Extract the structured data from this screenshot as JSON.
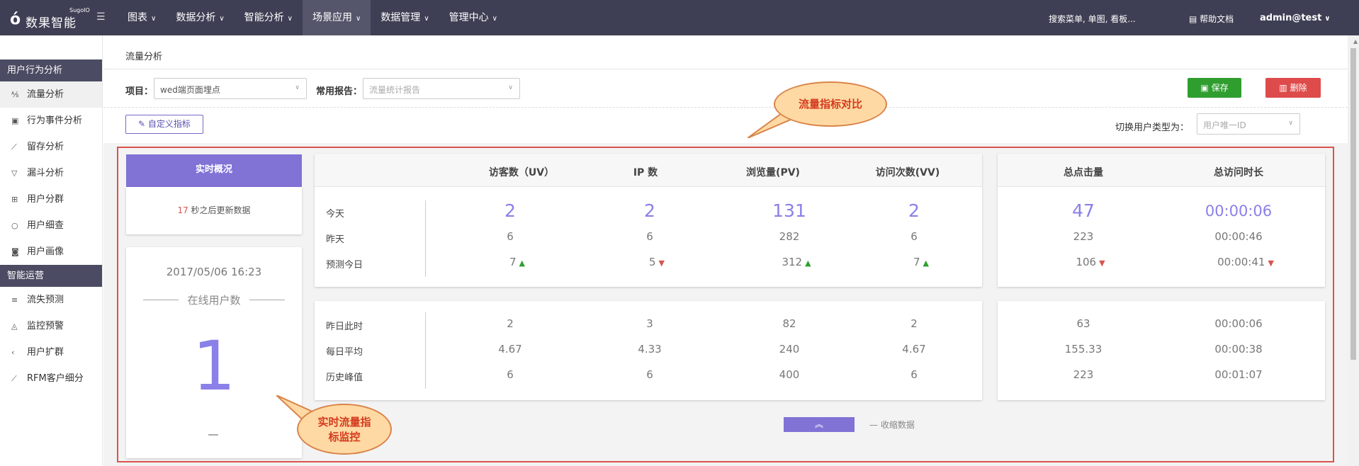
{
  "topbar": {
    "logo_mark": "ό",
    "logo_brand": "数果智能",
    "logo_sub": "SugoIO",
    "menu_icon": "☰",
    "nav": [
      {
        "label": "图表",
        "active": false
      },
      {
        "label": "数据分析",
        "active": false
      },
      {
        "label": "智能分析",
        "active": false
      },
      {
        "label": "场景应用",
        "active": true
      },
      {
        "label": "数据管理",
        "active": false
      },
      {
        "label": "管理中心",
        "active": false
      }
    ],
    "search_text": "搜索菜单, 单图, 看板...",
    "help_label": "帮助文档",
    "user": "admin@test"
  },
  "sidebar": {
    "sections": [
      {
        "title": "用户行为分析",
        "items": [
          {
            "label": "流量分析",
            "icon": "traffic-icon",
            "active": true
          },
          {
            "label": "行为事件分析",
            "icon": "event-icon",
            "active": false
          },
          {
            "label": "留存分析",
            "icon": "retention-icon",
            "active": false
          },
          {
            "label": "漏斗分析",
            "icon": "funnel-icon",
            "active": false
          },
          {
            "label": "用户分群",
            "icon": "group-icon",
            "active": false
          },
          {
            "label": "用户细查",
            "icon": "magnifier-icon",
            "active": false
          },
          {
            "label": "用户画像",
            "icon": "camera-icon",
            "active": false
          }
        ]
      },
      {
        "title": "智能运营",
        "items": [
          {
            "label": "流失预测",
            "icon": "list-icon",
            "active": false
          },
          {
            "label": "监控预警",
            "icon": "bell-icon",
            "active": false
          },
          {
            "label": "用户扩群",
            "icon": "share-icon",
            "active": false
          },
          {
            "label": "RFM客户细分",
            "icon": "chart-icon",
            "active": false
          }
        ]
      }
    ]
  },
  "page": {
    "title": "流量分析",
    "project_label": "项目：",
    "project_value": "wed端页面埋点",
    "report_label": "常用报告：",
    "report_placeholder": "流量统计报告",
    "save_label": "保存",
    "delete_label": "删除",
    "custom_metric_label": "自定义指标",
    "switch_label": "切换用户类型为：",
    "switch_placeholder": "用户唯一ID"
  },
  "realtime": {
    "header": "实时概况",
    "countdown": "17",
    "countdown_text": "秒之后更新数据",
    "datetime": "2017/05/06 16:23",
    "online_label": "在线用户数",
    "online_value": "1"
  },
  "metrics": {
    "headers": [
      "访客数（UV）",
      "IP 数",
      "浏览量(PV)",
      "访问次数(VV)"
    ],
    "headers_right": [
      "总点击量",
      "总访问时长"
    ],
    "rows_top": [
      {
        "label": "今天",
        "values": [
          "2",
          "2",
          "131",
          "2"
        ],
        "right": [
          "47",
          "00:00:06"
        ]
      },
      {
        "label": "昨天",
        "values": [
          "6",
          "6",
          "282",
          "6"
        ],
        "right": [
          "223",
          "00:00:46"
        ]
      },
      {
        "label": "预测今日",
        "values": [
          "7",
          "5",
          "312",
          "7"
        ],
        "trend": [
          "up",
          "down",
          "up",
          "up"
        ],
        "right": [
          "106",
          "00:00:41"
        ],
        "right_trend": [
          "down",
          "down"
        ]
      }
    ],
    "rows_bottom": [
      {
        "label": "昨日此时",
        "values": [
          "2",
          "3",
          "82",
          "2"
        ],
        "right": [
          "63",
          "00:00:06"
        ]
      },
      {
        "label": "每日平均",
        "values": [
          "4.67",
          "4.33",
          "240",
          "4.67"
        ],
        "right": [
          "155.33",
          "00:00:38"
        ]
      },
      {
        "label": "历史峰值",
        "values": [
          "6",
          "6",
          "400",
          "6"
        ],
        "right": [
          "223",
          "00:01:07"
        ]
      }
    ],
    "collapse_label": "— 收缩数据"
  },
  "annotations": {
    "compare": "流量指标对比",
    "monitor_1": "实时流量指",
    "monitor_2": "标监控"
  },
  "colors": {
    "topbar": "#3e3e54",
    "accent": "#8172d6",
    "value": "#8a80e8",
    "save": "#2f9e2f",
    "delete": "#de4b4b",
    "up": "#2f9e2f",
    "down": "#d9534f"
  }
}
